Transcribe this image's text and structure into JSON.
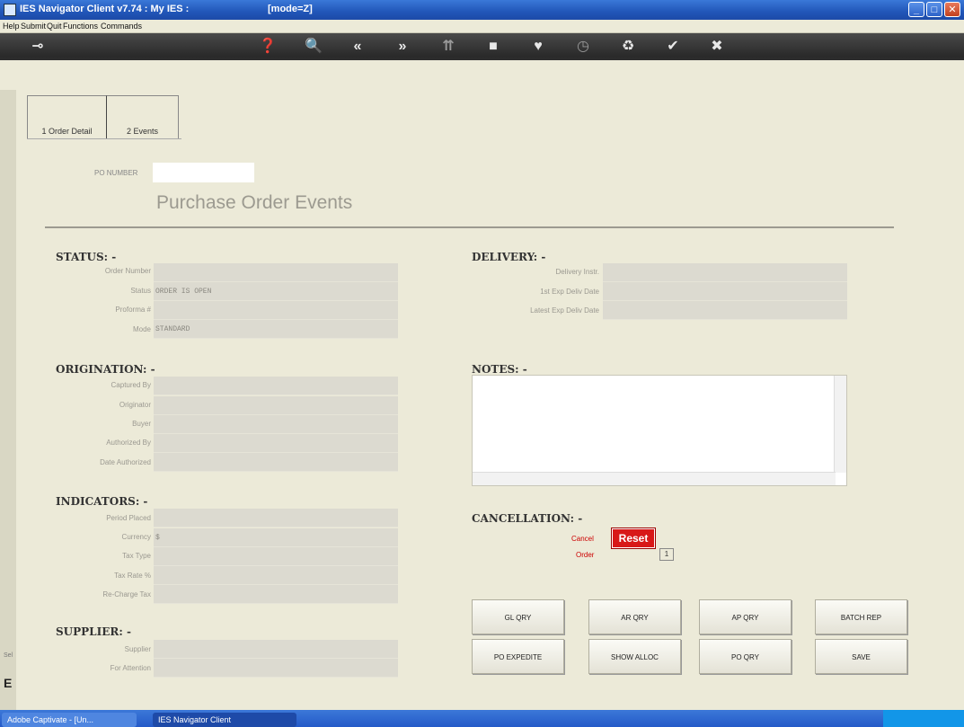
{
  "window": {
    "title": "IES Navigator Client v7.74 : My IES :",
    "mode": "[mode=Z]",
    "controls": [
      "_",
      "□",
      "✕"
    ]
  },
  "menu": [
    "Help",
    "Submit",
    "Quit",
    "Functions",
    "Commands"
  ],
  "toolbar": {
    "icons": [
      "key-icon",
      "help-icon",
      "search-icon",
      "rewind-icon",
      "fast-forward-icon",
      "tree-icon",
      "record-icon",
      "heart-icon",
      "clock-icon",
      "recycle-icon",
      "check-icon",
      "close-icon"
    ],
    "glyphs": [
      "⊸",
      "❓",
      "🔍",
      "«",
      "»",
      "⇈",
      "■",
      "♥",
      "◷",
      "♻",
      "✔",
      "✖"
    ]
  },
  "tabs": [
    {
      "label": "1 Order Detail"
    },
    {
      "label": "2 Events"
    }
  ],
  "po": {
    "label": "PO NUMBER",
    "value": ""
  },
  "page_title": "Purchase Order Events",
  "status": {
    "heading": "STATUS: -",
    "fields": [
      {
        "label": "Order Number",
        "value": ""
      },
      {
        "label": "Status",
        "value": "ORDER IS OPEN"
      },
      {
        "label": "Proforma #",
        "value": ""
      },
      {
        "label": "Mode",
        "value": "STANDARD"
      }
    ]
  },
  "origination": {
    "heading": "ORIGINATION: -",
    "fields": [
      {
        "label": "Captured By",
        "value": ""
      },
      {
        "label": "Originator",
        "value": ""
      },
      {
        "label": "Buyer",
        "value": ""
      },
      {
        "label": "Authorized By",
        "value": ""
      },
      {
        "label": "Date Authorized",
        "value": ""
      }
    ]
  },
  "indicators": {
    "heading": "INDICATORS: -",
    "fields": [
      {
        "label": "Period Placed",
        "value": ""
      },
      {
        "label": "Currency",
        "value": "$"
      },
      {
        "label": "Tax Type",
        "value": ""
      },
      {
        "label": "Tax Rate %",
        "value": ""
      },
      {
        "label": "Re-Charge Tax",
        "value": ""
      }
    ]
  },
  "supplier": {
    "heading": "SUPPLIER: -",
    "fields": [
      {
        "label": "Supplier",
        "value": ""
      },
      {
        "label": "For Attention",
        "value": ""
      }
    ]
  },
  "delivery": {
    "heading": "DELIVERY: -",
    "fields": [
      {
        "label": "Delivery Instr.",
        "value": ""
      },
      {
        "label": "1st Exp Deliv Date",
        "value": ""
      },
      {
        "label": "Latest Exp Deliv Date",
        "value": ""
      }
    ]
  },
  "notes": {
    "heading": "NOTES: -",
    "value": ""
  },
  "cancellation": {
    "heading": "CANCELLATION: -",
    "cancel_label": "Cancel",
    "order_label": "Order",
    "reset_label": "Reset",
    "order_value": "1"
  },
  "buttons": {
    "gl_qry": "GL QRY",
    "ar_qry": "AR QRY",
    "ap_qry": "AP QRY",
    "batch_rep": "BATCH REP",
    "po_expedite": "PO EXPEDITE",
    "show_alloc": "SHOW ALLOC",
    "po_qry": "PO QRY",
    "save": "SAVE"
  },
  "edge": {
    "sel": "Sel",
    "e": "E"
  },
  "taskbar": {
    "task1": "Adobe Captivate - [Un...",
    "task2": "IES Navigator Client"
  }
}
